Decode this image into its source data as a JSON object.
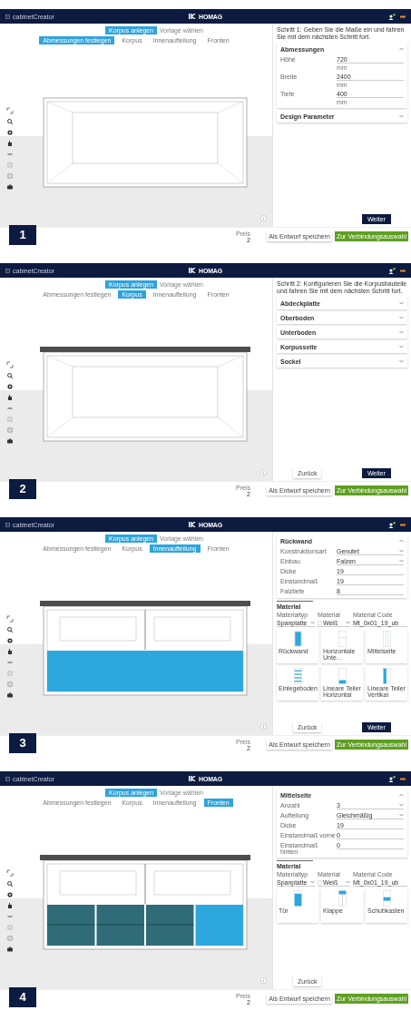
{
  "panels": [
    {
      "number": "1",
      "header": {
        "app": "cabinetCreator",
        "logo": "HOMAG"
      },
      "stepper": {
        "badge": "Korpus anlegen",
        "hint": "Vorlage wählen",
        "steps": [
          {
            "label": "Abmessungen festlegen",
            "selected": true
          },
          {
            "label": "Korpus",
            "selected": false
          },
          {
            "label": "Innenaufteilung",
            "selected": false
          },
          {
            "label": "Fronten",
            "selected": false
          }
        ]
      },
      "cabinet": {
        "top_plate": false,
        "upper_split": false
      },
      "sidebar": {
        "instruction": "Schritt 1: Geben Sie die Maße ein und fahren Sie mit dem nächsten Schritt fort.",
        "sections": [
          {
            "title": "Abmessungen",
            "expanded": true,
            "fields": [
              {
                "label": "Höhe",
                "value": "720",
                "unit": "mm",
                "kind": "input"
              },
              {
                "label": "Breite",
                "value": "2400",
                "unit": "mm",
                "kind": "input"
              },
              {
                "label": "Tiefe",
                "value": "400",
                "unit": "mm",
                "kind": "input"
              }
            ]
          },
          {
            "title": "Design Parameter",
            "expanded": false
          }
        ],
        "next": "Weiter"
      },
      "footer": {
        "counter_label": "Preis",
        "counter_value": "2",
        "draft": "Als Entwurf speichern",
        "proceed": "Zur Verbindungsauswahl"
      }
    },
    {
      "number": "2",
      "header": {
        "app": "cabinetCreator",
        "logo": "HOMAG"
      },
      "stepper": {
        "badge": "Korpus anlegen",
        "hint": "Vorlage wählen",
        "steps": [
          {
            "label": "Abmessungen festlegen",
            "selected": false
          },
          {
            "label": "Korpus",
            "selected": true
          },
          {
            "label": "Innenaufteilung",
            "selected": false
          },
          {
            "label": "Fronten",
            "selected": false
          }
        ]
      },
      "cabinet": {
        "top_plate": true,
        "upper_split": false
      },
      "sidebar": {
        "instruction": "Schritt 2: Konfigurieren Sie die Korpusbauteile und fahren Sie mit dem nächsten Schritt fort.",
        "sections": [
          {
            "title": "Abdeckplatte",
            "expanded": false
          },
          {
            "title": "Oberboden",
            "expanded": false
          },
          {
            "title": "Unterboden",
            "expanded": false
          },
          {
            "title": "Korpusseite",
            "expanded": false
          },
          {
            "title": "Sockel",
            "expanded": false
          }
        ],
        "back": "Zurück",
        "next": "Weiter"
      },
      "footer": {
        "counter_label": "Preis",
        "counter_value": "2",
        "draft": "Als Entwurf speichern",
        "proceed": "Zur Verbindungsauswahl"
      }
    },
    {
      "number": "3",
      "header": {
        "app": "cabinetCreator",
        "logo": "HOMAG"
      },
      "stepper": {
        "badge": "Korpus anlegen",
        "hint": "Vorlage wählen",
        "steps": [
          {
            "label": "Abmessungen festlegen",
            "selected": false
          },
          {
            "label": "Korpus",
            "selected": false
          },
          {
            "label": "Innenaufteilung",
            "selected": true
          },
          {
            "label": "Fronten",
            "selected": false
          }
        ]
      },
      "cabinet": {
        "top_plate": true,
        "upper_split": true,
        "lower_compartments": [
          {
            "kind": "highlighted"
          }
        ]
      },
      "sidebar": {
        "sections": [
          {
            "title": "Rückwand",
            "expanded": true,
            "fields": [
              {
                "label": "Konstruktionsart",
                "value": "Genutet",
                "kind": "select"
              },
              {
                "label": "Einbau",
                "value": "Falzen",
                "kind": "select"
              },
              {
                "label": "Dicke",
                "value": "19",
                "kind": "input"
              },
              {
                "label": "Einstandmaß",
                "value": "19",
                "kind": "input"
              },
              {
                "label": "Falztiefe",
                "value": "8",
                "kind": "input"
              }
            ]
          }
        ],
        "material": {
          "title": "Material",
          "type_label": "Materialtyp",
          "type": "Spanplatte",
          "material_label": "Material",
          "material": "Weiß",
          "code_label": "Material Code",
          "code": "Mt_0x01_19_ub"
        },
        "tiles": [
          {
            "label": "Rückwand",
            "kind": "back-panel"
          },
          {
            "label": "Horizontale Unte...",
            "kind": "horizontal-divider"
          },
          {
            "label": "Mittelseite",
            "kind": "middle-side"
          },
          {
            "label": "Einlegeboden",
            "kind": "shelves"
          },
          {
            "label": "Lineare Teiler Horizontal",
            "kind": "bottom-block"
          },
          {
            "label": "Lineare Teiler Vertikal",
            "kind": "side-bar"
          }
        ],
        "back": "Zurück",
        "next": "Weiter"
      },
      "footer": {
        "counter_label": "Preis",
        "counter_value": "2",
        "draft": "Als Entwurf speichern",
        "proceed": "Zur Verbindungsauswahl"
      }
    },
    {
      "number": "4",
      "header": {
        "app": "cabinetCreator",
        "logo": "HOMAG"
      },
      "stepper": {
        "badge": "Korpus anlegen",
        "hint": "Vorlage wählen",
        "steps": [
          {
            "label": "Abmessungen festlegen",
            "selected": false
          },
          {
            "label": "Korpus",
            "selected": false
          },
          {
            "label": "Innenaufteilung",
            "selected": false
          },
          {
            "label": "Fronten",
            "selected": true
          }
        ]
      },
      "cabinet": {
        "top_plate": true,
        "upper_split": true,
        "lower_compartments": [
          {
            "kind": "dark"
          },
          {
            "kind": "dark"
          },
          {
            "kind": "dark"
          },
          {
            "kind": "highlighted"
          }
        ]
      },
      "sidebar": {
        "sections": [
          {
            "title": "Mittelseite",
            "expanded": true,
            "fields": [
              {
                "label": "Anzahl",
                "value": "3",
                "kind": "select"
              },
              {
                "label": "Aufteilung",
                "value": "Gleichmäßig",
                "kind": "select"
              },
              {
                "label": "Dicke",
                "value": "19",
                "kind": "input"
              },
              {
                "label": "Einstandmaß vorne",
                "value": "0",
                "kind": "input"
              },
              {
                "label": "Einstandmaß hinten",
                "value": "0",
                "kind": "input"
              }
            ]
          }
        ],
        "material": {
          "title": "Material",
          "type_label": "Materialtyp",
          "type": "Spanplatte",
          "material_label": "Material",
          "material": "Weiß",
          "code_label": "Material Code",
          "code": "Mt_0x01_19_ub"
        },
        "tiles": [
          {
            "label": "Tür",
            "kind": "door"
          },
          {
            "label": "Klappe",
            "kind": "flap"
          },
          {
            "label": "Schubkasten",
            "kind": "drawer"
          }
        ],
        "back": "Zurück"
      },
      "footer": {
        "counter_label": "Preis",
        "counter_value": "2",
        "draft": "Als Entwurf speichern",
        "proceed": "Zur Verbindungsauswahl"
      }
    }
  ]
}
